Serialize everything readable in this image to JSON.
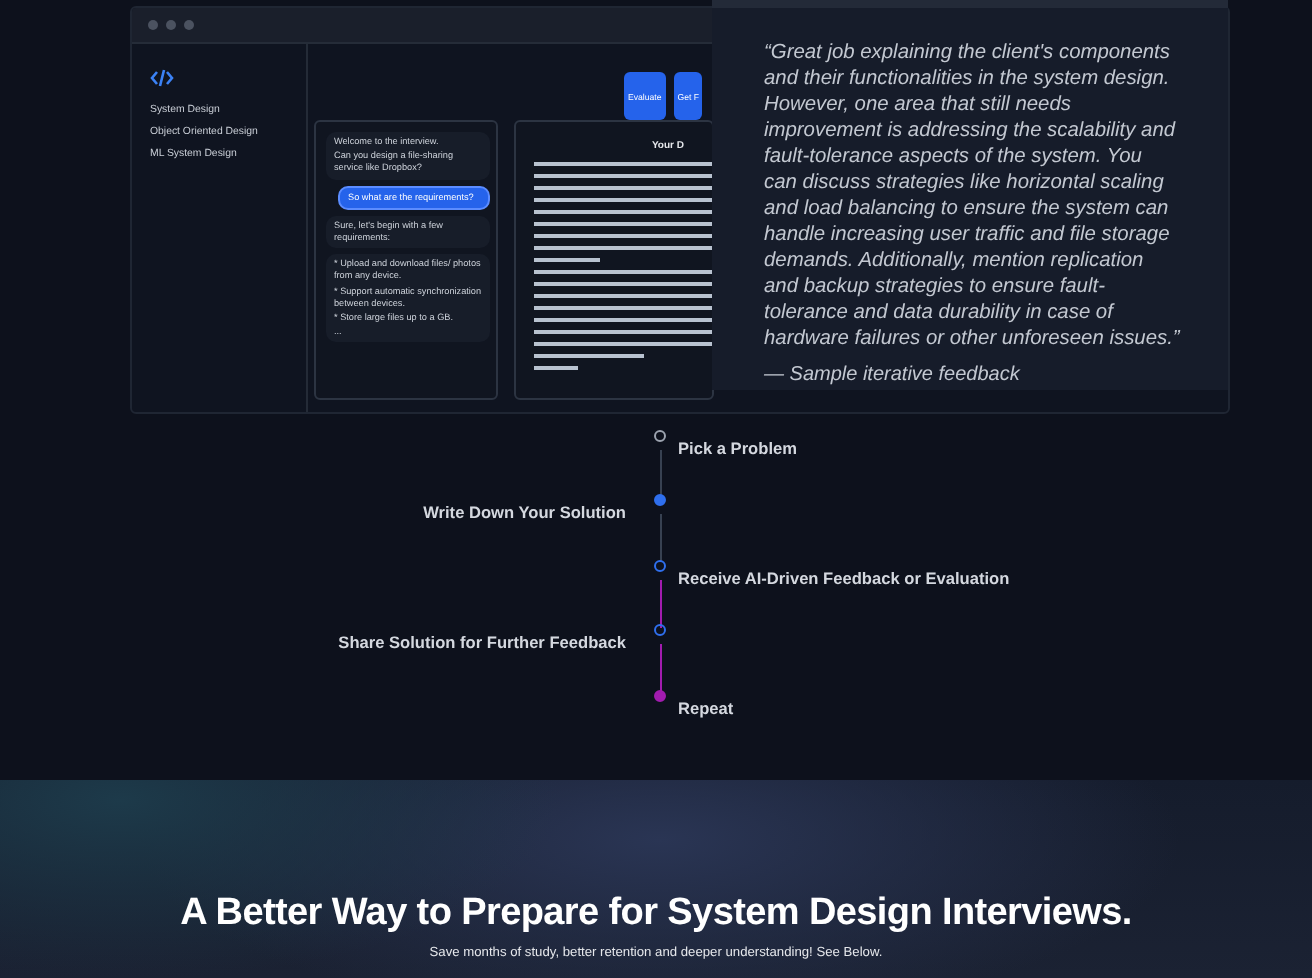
{
  "app_window": {
    "sidebar_items": [
      "System Design",
      "Object Oriented Design",
      "ML System Design"
    ],
    "buttons": [
      {
        "label": "Evaluate"
      },
      {
        "label": "Get F"
      }
    ],
    "chat": [
      {
        "kind": "bot",
        "paragraphs": [
          "Welcome to the interview.",
          "Can you design a file-sharing service like Dropbox?"
        ]
      },
      {
        "kind": "user",
        "paragraphs": [
          "So what are the requirements?"
        ]
      },
      {
        "kind": "bot",
        "paragraphs": [
          "Sure, let's begin with a few requirements:"
        ]
      },
      {
        "kind": "bot",
        "paragraphs": [
          "* Upload and download files/ photos from any device.",
          "* Support automatic synchronization between devices.",
          "* Store large files up to a GB.",
          "..."
        ]
      }
    ],
    "design_panel": {
      "title": "Your D"
    }
  },
  "quote": {
    "text": "“Great job explaining the client's components and their functionalities in the system design. However, one area that still needs improvement is addressing the scalability and fault-tolerance aspects of the system. You can discuss strategies like horizontal scaling and load balancing to ensure the system can handle increasing user traffic and file storage demands. Additionally, mention replication and backup strategies to ensure fault-tolerance and data durability in case of hardware failures or other unforeseen issues.”",
    "attribution": "— Sample iterative feedback"
  },
  "steps": [
    {
      "label": "Pick a Problem",
      "filled": false,
      "color": "#9ca3af"
    },
    {
      "label": "Write Down Your Solution",
      "filled": true,
      "color": "#2f6fed"
    },
    {
      "label": "Receive AI-Driven Feedback or Evaluation",
      "filled": false,
      "color": "#2f6fed"
    },
    {
      "label": "Share Solution for Further Feedback",
      "filled": false,
      "color": "#2f6fed"
    },
    {
      "label": "Repeat",
      "filled": true,
      "color": "#a21caf"
    }
  ],
  "connectors": [
    {
      "color": "#374151"
    },
    {
      "color": "#374151"
    },
    {
      "color": "#a21caf"
    },
    {
      "color": "#a21caf"
    }
  ],
  "hero": {
    "title": "A Better Way to Prepare for System Design Interviews.",
    "subtitle": "Save months of study, better retention and deeper understanding! See Below."
  }
}
